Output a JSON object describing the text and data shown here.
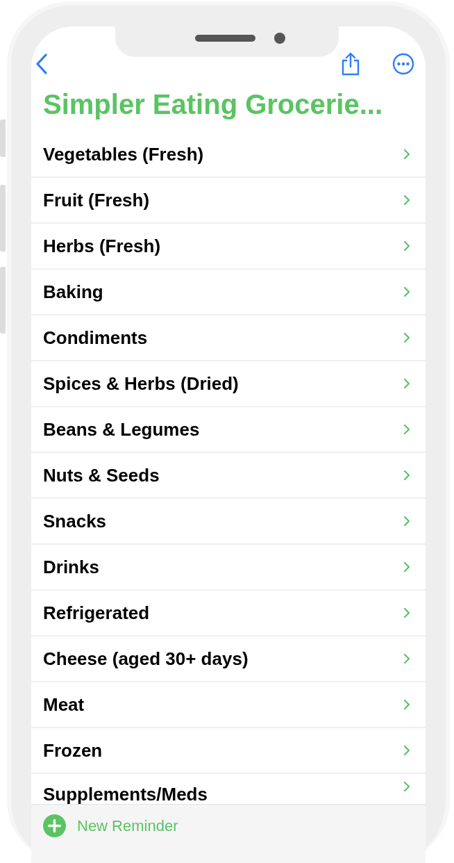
{
  "list_title": "Simpler Eating Grocerie...",
  "groups": [
    {
      "label": "Vegetables (Fresh)"
    },
    {
      "label": "Fruit (Fresh)"
    },
    {
      "label": "Herbs (Fresh)"
    },
    {
      "label": "Baking"
    },
    {
      "label": "Condiments"
    },
    {
      "label": "Spices & Herbs (Dried)"
    },
    {
      "label": "Beans & Legumes"
    },
    {
      "label": "Nuts & Seeds"
    },
    {
      "label": "Snacks"
    },
    {
      "label": "Drinks"
    },
    {
      "label": "Refrigerated"
    },
    {
      "label": "Cheese (aged 30+ days)"
    },
    {
      "label": "Meat"
    },
    {
      "label": "Frozen"
    },
    {
      "label": "Supplements/Meds"
    }
  ],
  "toolbar": {
    "label": "New Reminder"
  }
}
